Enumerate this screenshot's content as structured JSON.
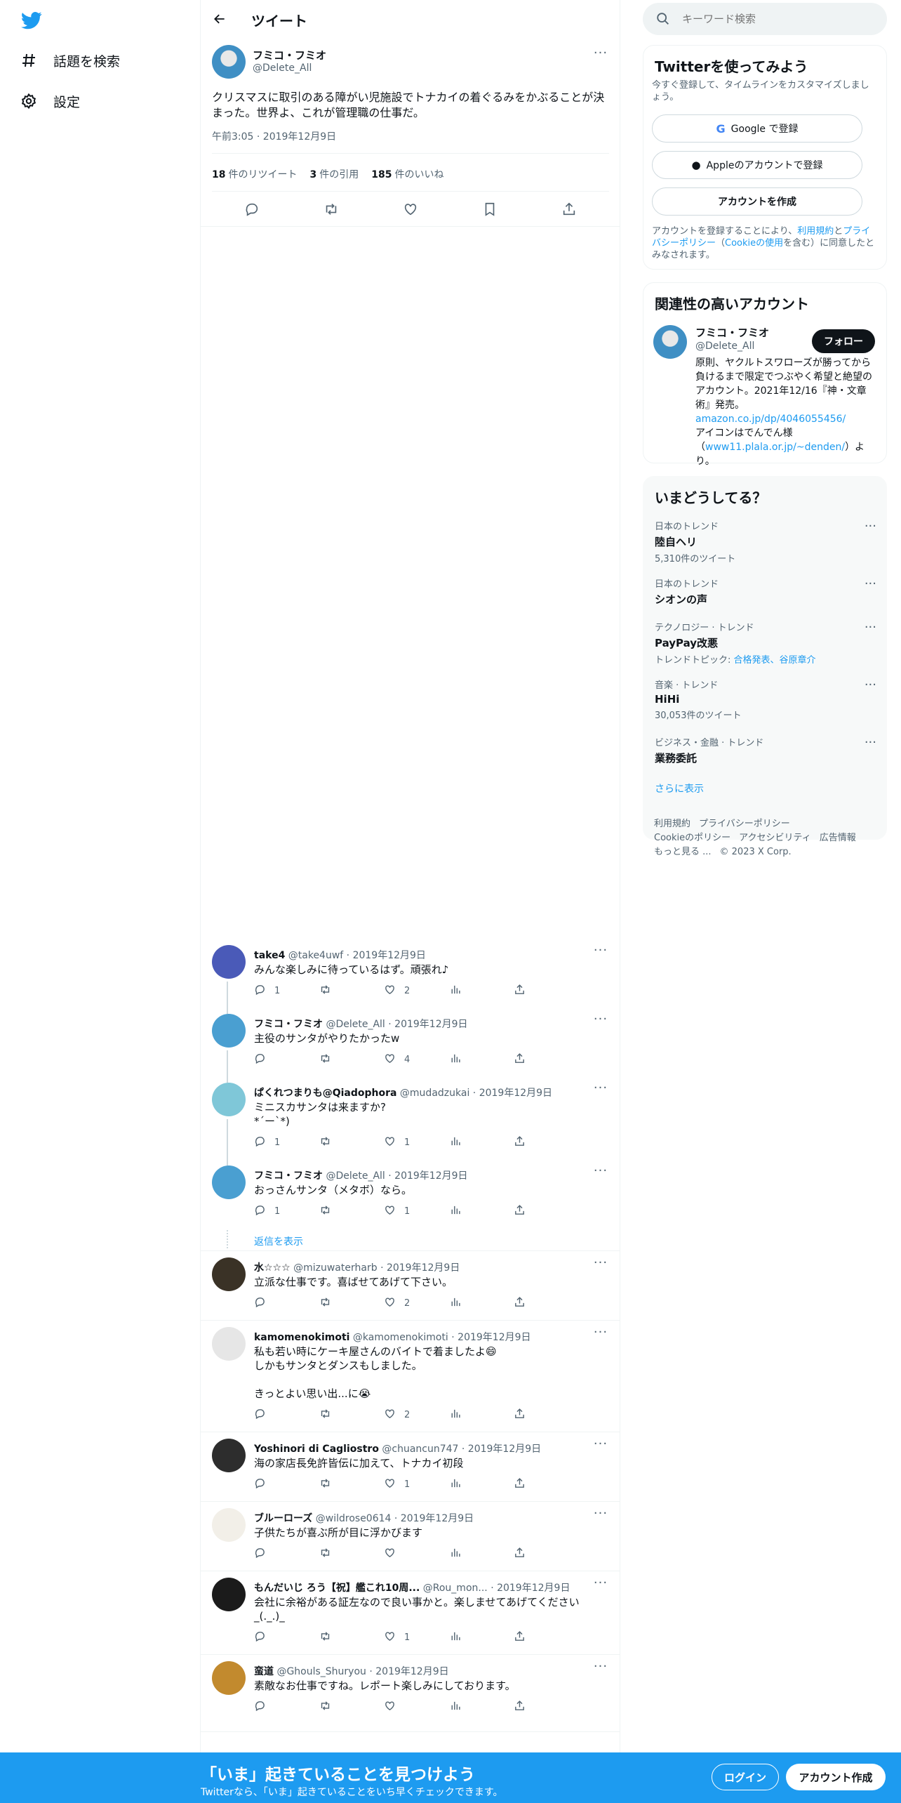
{
  "nav": {
    "explore_label": "話題を検索",
    "settings_label": "設定"
  },
  "header": {
    "title": "ツイート"
  },
  "tweet": {
    "author_name": "フミコ・フミオ",
    "author_handle": "@Delete_All",
    "text": "クリスマスに取引のある障がい児施設でトナカイの着ぐるみをかぶることが決まった。世界よ、これが管理職の仕事だ。",
    "time": "午前3:05 · 2019年12月9日",
    "retweets": "18",
    "retweets_label": "件のリツイート",
    "quotes": "3",
    "quotes_label": "件の引用",
    "likes": "185",
    "likes_label": "件のいいね"
  },
  "replies": [
    {
      "name": "take4",
      "handle": "@take4uwf",
      "date": "· 2019年12月9日",
      "text": "みんな楽しみに待っているはず。頑張れ♪",
      "replies": "1",
      "retweets": "",
      "likes": "2",
      "avatar_color": "#4a5ab8"
    },
    {
      "name": "フミコ・フミオ",
      "handle": "@Delete_All",
      "date": "· 2019年12月9日",
      "text": "主役のサンタがやりたかったw",
      "replies": "",
      "retweets": "",
      "likes": "4",
      "avatar_color": "#4a9fd1"
    },
    {
      "name": "ぱくれつまりも@Qiadophora",
      "handle": "@mudadzukai",
      "date": "· 2019年12月9日",
      "text": "ミニスカサンタは来ますか?\n*´ー`*)",
      "replies": "1",
      "retweets": "",
      "likes": "1",
      "avatar_color": "#7fc7d8"
    },
    {
      "name": "フミコ・フミオ",
      "handle": "@Delete_All",
      "date": "· 2019年12月9日",
      "text": "おっさんサンタ（メタボ）なら。",
      "replies": "1",
      "retweets": "",
      "likes": "1",
      "avatar_color": "#4a9fd1"
    },
    {
      "name": "水☆☆☆",
      "handle": "@mizuwaterharb",
      "date": "· 2019年12月9日",
      "text": "立派な仕事です。喜ばせてあげて下さい。",
      "replies": "",
      "retweets": "",
      "likes": "2",
      "avatar_color": "#3a3226"
    },
    {
      "name": "kamomenokimoti",
      "handle": "@kamomenokimoti",
      "date": "· 2019年12月9日",
      "text": "私も若い時にケーキ屋さんのバイトで着ましたよ😄\nしかもサンタとダンスもしました。\n\nきっとよい思い出...に😭",
      "replies": "",
      "retweets": "",
      "likes": "2",
      "avatar_color": "#e6e6e6"
    },
    {
      "name": "Yoshinori di Cagliostro",
      "handle": "@chuancun747",
      "date": "· 2019年12月9日",
      "text": "海の家店長免許皆伝に加えて、トナカイ初段",
      "replies": "",
      "retweets": "",
      "likes": "1",
      "avatar_color": "#2d2d2d"
    },
    {
      "name": "ブルーローズ",
      "handle": "@wildrose0614",
      "date": "· 2019年12月9日",
      "text": "子供たちが喜ぶ所が目に浮かびます",
      "replies": "",
      "retweets": "",
      "likes": "",
      "avatar_color": "#f2efe8"
    },
    {
      "name": "もんだいじ ろう【祝】艦これ10周...",
      "handle": "@Rou_mon...",
      "date": "· 2019年12月9日",
      "text": "会社に余裕がある証左なので良い事かと。楽しませてあげてください\n_(._.)_",
      "replies": "",
      "retweets": "",
      "likes": "1",
      "avatar_color": "#1b1b1b"
    },
    {
      "name": "蛮道",
      "handle": "@Ghouls_Shuryou",
      "date": "· 2019年12月9日",
      "text": "素敵なお仕事ですね。レポート楽しみにしております。",
      "replies": "",
      "retweets": "",
      "likes": "",
      "avatar_color": "#c28a2e"
    }
  ],
  "show_replies_label": "返信を表示",
  "search": {
    "placeholder": "キーワード検索"
  },
  "signup_card": {
    "title": "Twitterを使ってみよう",
    "subtitle": "今すぐ登録して、タイムラインをカスタマイズしましょう。",
    "google_label": "Google で登録",
    "apple_label": "Appleのアカウントで登録",
    "create_label": "アカウントを作成",
    "terms_prefix": "アカウントを登録することにより、",
    "terms_link": "利用規約",
    "terms_and": "と",
    "privacy_link": "プライバシーポリシー",
    "cookie_open": "（",
    "cookie_link": "Cookieの使用",
    "terms_suffix": "を含む）に同意したとみなされます。"
  },
  "relevant": {
    "title": "関連性の高いアカウント",
    "name": "フミコ・フミオ",
    "handle": "@Delete_All",
    "follow_label": "フォロー",
    "bio_1": "原則、ヤクルトスワローズが勝ってから負けるまで限定でつぶやく希望と絶望のアカウント。2021年12/16『神・文章術』発売。",
    "bio_link": "amazon.co.jp/dp/4046055456/",
    "bio_2": "アイコンはでんでん様（",
    "bio_link2": "www11.plala.or.jp/~denden/",
    "bio_3": "）より。"
  },
  "trends": {
    "title": "いまどうしてる？",
    "items": [
      {
        "category": "日本のトレンド",
        "name": "陸自ヘリ",
        "sub": "5,310件のツイート"
      },
      {
        "category": "日本のトレンド",
        "name": "シオンの声",
        "sub": ""
      },
      {
        "category": "テクノロジー · トレンド",
        "name": "PayPay改悪",
        "sub": "トレンドトピック: ",
        "links": "合格発表、谷原章介"
      },
      {
        "category": "音楽 · トレンド",
        "name": "HiHi",
        "sub": "30,053件のツイート"
      },
      {
        "category": "ビジネス・金融 · トレンド",
        "name": "業務委託",
        "sub": ""
      }
    ],
    "show_more": "さらに表示"
  },
  "footer": {
    "terms": "利用規約",
    "privacy": "プライバシーポリシー",
    "cookie": "Cookieのポリシー",
    "accessibility": "アクセシビリティ",
    "ads": "広告情報",
    "more": "もっと見る ...",
    "copyright": "© 2023 X Corp."
  },
  "bottom_bar": {
    "title": "「いま」起きていることを見つけよう",
    "subtitle": "Twitterなら、「いま」起きていることをいち早くチェックできます。",
    "login_label": "ログイン",
    "signup_label": "アカウント作成"
  },
  "colors": {
    "accent": "#1d9bf0",
    "text": "#0f1419",
    "muted": "#536471"
  }
}
